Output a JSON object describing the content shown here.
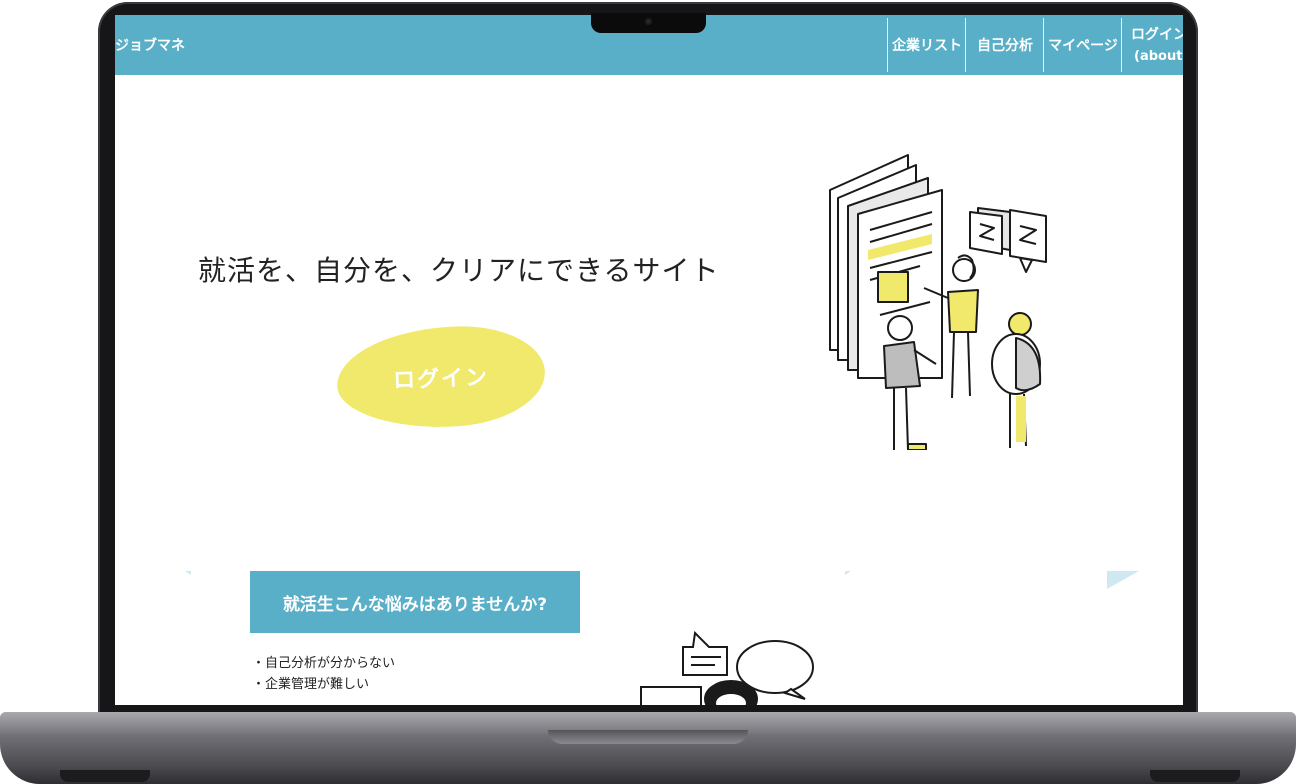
{
  "navbar": {
    "brand": "ジョブマネ",
    "items": [
      "企業リスト",
      "自己分析",
      "マイページ"
    ],
    "login_label": "ログイン",
    "about_label": "(about)"
  },
  "hero": {
    "tagline": "就活を、自分を、クリアにできるサイト",
    "login_button": "ログイン"
  },
  "worries": {
    "title": "就活生こんな悩みはありませんか?",
    "items": [
      "・自己分析が分からない",
      "・企業管理が難しい"
    ]
  },
  "colors": {
    "nav": "#5aafc8",
    "accent_yellow": "#f1e96b"
  }
}
